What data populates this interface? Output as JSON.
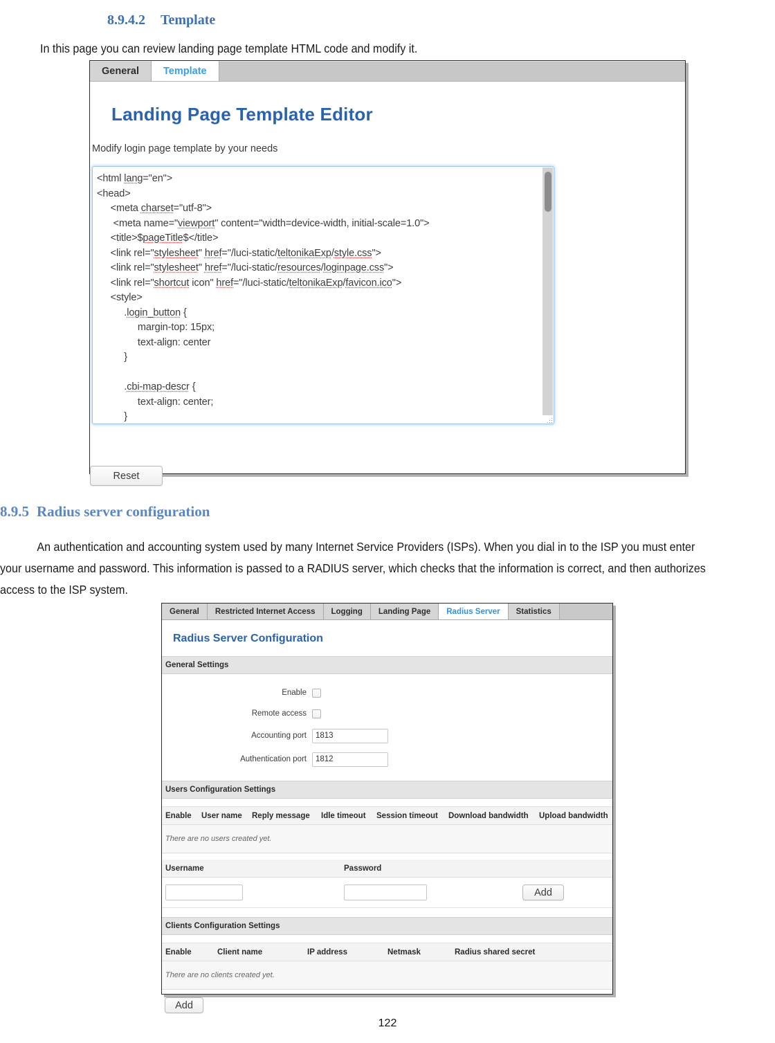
{
  "document": {
    "section_template": {
      "number": "8.9.4.2",
      "title": "Template"
    },
    "intro_paragraph": "In this page you can review landing page template HTML code and modify it.",
    "section_radius": {
      "number": "8.9.5",
      "title": "Radius server configuration"
    },
    "radius_paragraph": "An authentication and accounting system used by many Internet Service Providers (ISPs). When you dial in to the ISP you must enter your username and password. This information is passed to a RADIUS server, which checks that the information is correct, and then authorizes access to the ISP system.",
    "page_number": "122"
  },
  "template_screenshot": {
    "tabs": [
      {
        "label": "General",
        "active": false
      },
      {
        "label": "Template",
        "active": true
      }
    ],
    "title": "Landing Page Template Editor",
    "description": "Modify login page template by your needs",
    "code": "<html lang=\"en\">\n<head>\n     <meta charset=\"utf-8\">\n      <meta name=\"viewport\" content=\"width=device-width, initial-scale=1.0\">\n     <title>$pageTitle$</title>\n     <link rel=\"stylesheet\" href=\"/luci-static/teltonikaExp/style.css\">\n     <link rel=\"stylesheet\" href=\"/luci-static/resources/loginpage.css\">\n     <link rel=\"shortcut icon\" href=\"/luci-static/teltonikaExp/favicon.ico\">\n     <style>\n          .login_button {\n               margin-top: 15px;\n               text-align: center\n          }\n\n          .cbi-map-descr {\n               text-align: center;\n          }",
    "reset_label": "Reset"
  },
  "radius_screenshot": {
    "tabs": [
      {
        "label": "General",
        "active": false
      },
      {
        "label": "Restricted Internet Access",
        "active": false
      },
      {
        "label": "Logging",
        "active": false
      },
      {
        "label": "Landing Page",
        "active": false
      },
      {
        "label": "Radius Server",
        "active": true
      },
      {
        "label": "Statistics",
        "active": false
      }
    ],
    "title": "Radius Server Configuration",
    "general_settings": {
      "heading": "General Settings",
      "fields": [
        {
          "label": "Enable",
          "type": "checkbox",
          "value": ""
        },
        {
          "label": "Remote access",
          "type": "checkbox",
          "value": ""
        },
        {
          "label": "Accounting port",
          "type": "text",
          "value": "1813"
        },
        {
          "label": "Authentication port",
          "type": "text",
          "value": "1812"
        }
      ]
    },
    "users_settings": {
      "heading": "Users Configuration Settings",
      "columns": [
        "Enable",
        "User name",
        "Reply message",
        "Idle timeout",
        "Session timeout",
        "Download bandwidth",
        "Upload bandwidth"
      ],
      "empty_message": "There are no users created yet.",
      "add_form": {
        "username_label": "Username",
        "password_label": "Password",
        "username_value": "",
        "password_value": "",
        "add_label": "Add"
      }
    },
    "clients_settings": {
      "heading": "Clients Configuration Settings",
      "columns": [
        "Enable",
        "Client name",
        "IP address",
        "Netmask",
        "Radius shared secret"
      ],
      "empty_message": "There are no clients created yet.",
      "add_label": "Add"
    }
  },
  "colors": {
    "heading_blue": "#3d70b2",
    "subheading_blue": "#5b86c4",
    "panel_title_blue": "#2a62ab",
    "active_tab_blue": "#2f93e0",
    "tabbar_gray": "#c9c9c9",
    "section_header_gray": "#e4e4e4"
  }
}
